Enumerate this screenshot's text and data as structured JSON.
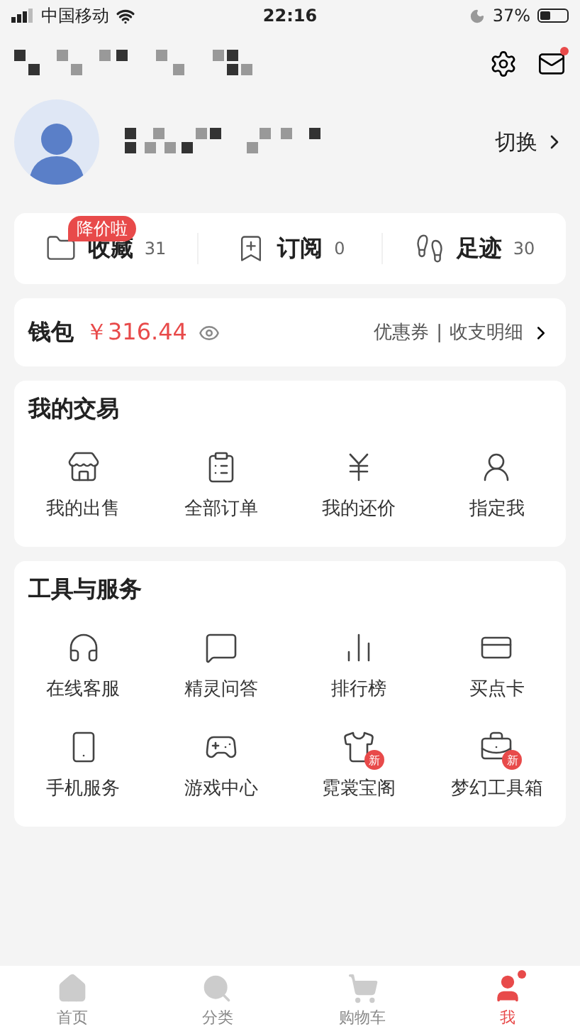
{
  "status_bar": {
    "carrier": "中国移动",
    "time": "22:16",
    "battery": "37%"
  },
  "header": {
    "mail_unread": true
  },
  "profile": {
    "switch_label": "切换"
  },
  "shortcuts": [
    {
      "label": "收藏",
      "count": "31",
      "badge": "降价啦"
    },
    {
      "label": "订阅",
      "count": "0"
    },
    {
      "label": "足迹",
      "count": "30"
    }
  ],
  "wallet": {
    "label": "钱包",
    "amount": "￥316.44",
    "link_1": "优惠券",
    "separator": "|",
    "link_2": "收支明细"
  },
  "trade": {
    "title": "我的交易",
    "items": [
      {
        "label": "我的出售"
      },
      {
        "label": "全部订单"
      },
      {
        "label": "我的还价"
      },
      {
        "label": "指定我"
      }
    ]
  },
  "tools": {
    "title": "工具与服务",
    "items": [
      {
        "label": "在线客服"
      },
      {
        "label": "精灵问答"
      },
      {
        "label": "排行榜"
      },
      {
        "label": "买点卡"
      },
      {
        "label": "手机服务"
      },
      {
        "label": "游戏中心"
      },
      {
        "label": "霓裳宝阁",
        "badge": "新"
      },
      {
        "label": "梦幻工具箱",
        "badge": "新"
      }
    ]
  },
  "nav": [
    {
      "label": "首页",
      "selected": false,
      "notification": false
    },
    {
      "label": "分类",
      "selected": false,
      "notification": false
    },
    {
      "label": "购物车",
      "selected": false,
      "notification": false
    },
    {
      "label": "我",
      "selected": true,
      "notification": true
    }
  ]
}
